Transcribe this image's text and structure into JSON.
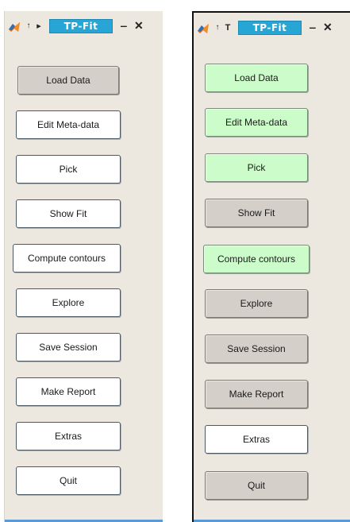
{
  "colors": {
    "window_bg": "#ece8df",
    "title_pill": "#27a6d6",
    "button_white": "#ffffff",
    "button_grey": "#d4cfc8",
    "button_green": "#ccfcca",
    "bottom_strip": "#5b9bd5"
  },
  "panels": [
    {
      "title": "TP-Fit",
      "icons": [
        "matlab-icon",
        "arrow-up-icon",
        "next-icon",
        "minimize-icon",
        "close-icon"
      ],
      "controls": {
        "up": "↑",
        "nav": "▸",
        "minimize": "‒",
        "close": "✕"
      },
      "buttons": [
        {
          "label": "Load Data",
          "state": "grey"
        },
        {
          "label": "Edit Meta-data",
          "state": "white"
        },
        {
          "label": "Pick",
          "state": "white"
        },
        {
          "label": "Show Fit",
          "state": "white"
        },
        {
          "label": "Compute contours",
          "state": "white"
        },
        {
          "label": "Explore",
          "state": "white"
        },
        {
          "label": "Save Session",
          "state": "white"
        },
        {
          "label": "Make Report",
          "state": "white"
        },
        {
          "label": "Extras",
          "state": "white"
        },
        {
          "label": "Quit",
          "state": "white"
        }
      ]
    },
    {
      "title": "TP-Fit",
      "icons": [
        "matlab-icon",
        "arrow-up-icon",
        "pin-icon",
        "minimize-icon",
        "close-icon"
      ],
      "controls": {
        "up": "↑",
        "nav": "T",
        "minimize": "‒",
        "close": "✕"
      },
      "buttons": [
        {
          "label": "Load Data",
          "state": "green"
        },
        {
          "label": "Edit Meta-data",
          "state": "green"
        },
        {
          "label": "Pick",
          "state": "green"
        },
        {
          "label": "Show Fit",
          "state": "grey"
        },
        {
          "label": "Compute contours",
          "state": "green"
        },
        {
          "label": "Explore",
          "state": "grey"
        },
        {
          "label": "Save Session",
          "state": "grey"
        },
        {
          "label": "Make Report",
          "state": "grey"
        },
        {
          "label": "Extras",
          "state": "white"
        },
        {
          "label": "Quit",
          "state": "grey"
        }
      ]
    }
  ]
}
